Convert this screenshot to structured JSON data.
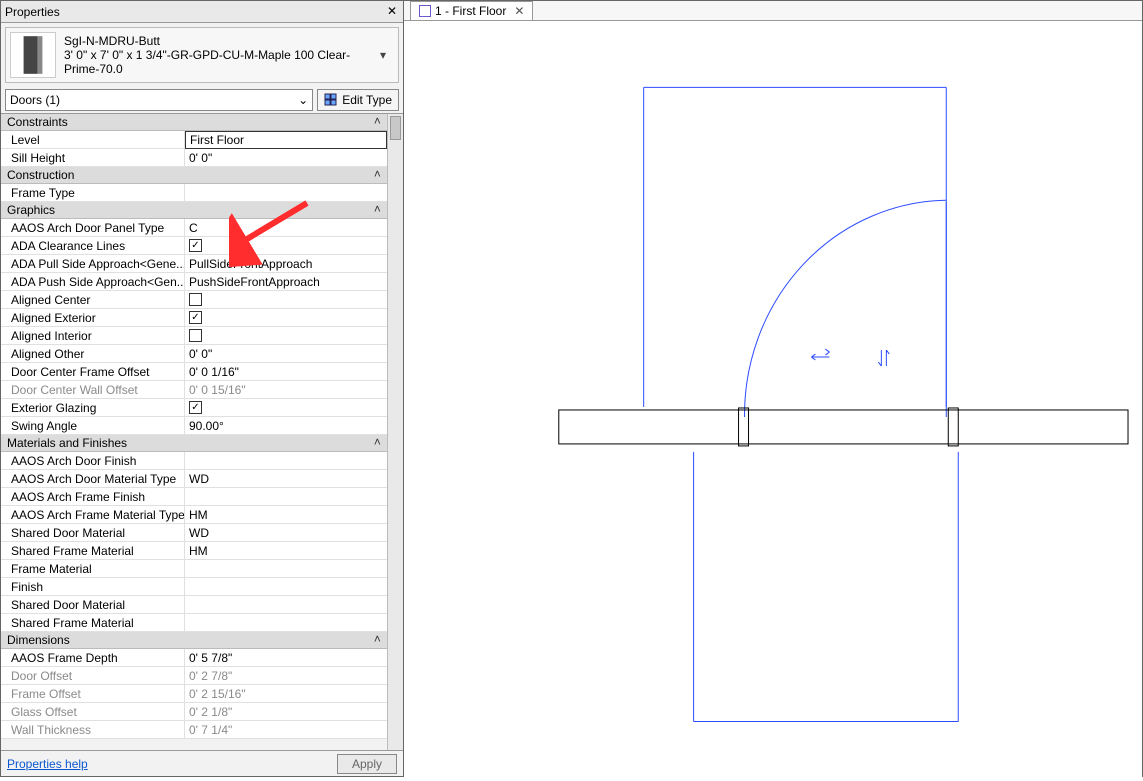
{
  "palette": {
    "title": "Properties",
    "type_name": "SgI-N-MDRU-Butt",
    "type_desc": "3' 0\" x 7' 0\" x 1 3/4\"-GR-GPD-CU-M-Maple 100 Clear-Prime-70.0",
    "category_filter": "Doors (1)",
    "edit_type_label": "Edit Type",
    "help_label": "Properties help",
    "apply_label": "Apply"
  },
  "groups": [
    {
      "title": "Constraints",
      "rows": [
        {
          "label": "Level",
          "value": "First Floor",
          "kind": "boxed"
        },
        {
          "label": "Sill Height",
          "value": "0'  0\"",
          "kind": "text"
        }
      ]
    },
    {
      "title": "Construction",
      "rows": [
        {
          "label": "Frame Type",
          "value": "",
          "kind": "text"
        }
      ]
    },
    {
      "title": "Graphics",
      "rows": [
        {
          "label": "AAOS Arch Door Panel Type",
          "value": "C",
          "kind": "text"
        },
        {
          "label": "ADA Clearance Lines",
          "value": true,
          "kind": "check"
        },
        {
          "label": "ADA Pull Side Approach<Gene...",
          "value": "PullSideFrontApproach",
          "kind": "text"
        },
        {
          "label": "ADA Push Side Approach<Gen...",
          "value": "PushSideFrontApproach",
          "kind": "text"
        },
        {
          "label": "Aligned Center",
          "value": false,
          "kind": "check"
        },
        {
          "label": "Aligned Exterior",
          "value": true,
          "kind": "check"
        },
        {
          "label": "Aligned Interior",
          "value": false,
          "kind": "check"
        },
        {
          "label": "Aligned Other",
          "value": "0'  0\"",
          "kind": "text"
        },
        {
          "label": "Door Center Frame Offset",
          "value": "0'  0 1/16\"",
          "kind": "text"
        },
        {
          "label": "Door Center Wall Offset",
          "value": "0'  0 15/16\"",
          "kind": "text",
          "disabled": true
        },
        {
          "label": "Exterior Glazing",
          "value": true,
          "kind": "check"
        },
        {
          "label": "Swing Angle",
          "value": "90.00°",
          "kind": "text"
        }
      ]
    },
    {
      "title": "Materials and Finishes",
      "rows": [
        {
          "label": "AAOS Arch Door Finish",
          "value": "",
          "kind": "text"
        },
        {
          "label": "AAOS Arch Door Material Type",
          "value": "WD",
          "kind": "text"
        },
        {
          "label": "AAOS Arch Frame Finish",
          "value": "",
          "kind": "text"
        },
        {
          "label": "AAOS Arch Frame Material Type",
          "value": "HM",
          "kind": "text"
        },
        {
          "label": "Shared Door Material",
          "value": "WD",
          "kind": "text"
        },
        {
          "label": "Shared Frame Material",
          "value": "HM",
          "kind": "text"
        },
        {
          "label": "Frame Material",
          "value": "",
          "kind": "text"
        },
        {
          "label": "Finish",
          "value": "",
          "kind": "text"
        },
        {
          "label": "Shared Door Material",
          "value": "",
          "kind": "text"
        },
        {
          "label": "Shared Frame Material",
          "value": "",
          "kind": "text"
        }
      ]
    },
    {
      "title": "Dimensions",
      "rows": [
        {
          "label": "AAOS Frame Depth",
          "value": "0'  5 7/8\"",
          "kind": "text"
        },
        {
          "label": "Door Offset",
          "value": "0'  2 7/8\"",
          "kind": "text",
          "disabled": true
        },
        {
          "label": "Frame Offset",
          "value": "0'  2 15/16\"",
          "kind": "text",
          "disabled": true
        },
        {
          "label": "Glass Offset",
          "value": "0'  2 1/8\"",
          "kind": "text",
          "disabled": true
        },
        {
          "label": "Wall Thickness",
          "value": "0'  7 1/4\"",
          "kind": "text",
          "disabled": true
        }
      ]
    }
  ],
  "view_tab": {
    "label": "1 - First Floor"
  }
}
